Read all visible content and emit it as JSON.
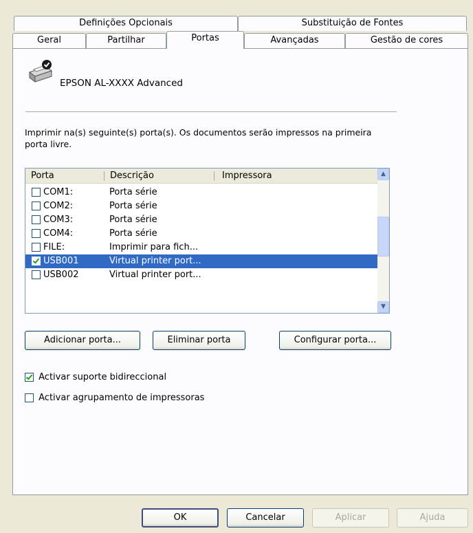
{
  "tabs": {
    "row1": [
      "Definições Opcionais",
      "Substituição de Fontes"
    ],
    "row2": [
      "Geral",
      "Partilhar",
      "Portas",
      "Avançadas",
      "Gestão de cores"
    ]
  },
  "printer": {
    "name": "EPSON AL-XXXX Advanced",
    "icon": "printer-icon"
  },
  "instruction": "Imprimir na(s) seguinte(s) porta(s). Os documentos serão impressos na primeira porta livre.",
  "ports_table": {
    "columns": [
      "Porta",
      "Descrição",
      "Impressora"
    ],
    "rows": [
      {
        "port": "COM1:",
        "description": "Porta série",
        "printer": "",
        "checked": false,
        "selected": false
      },
      {
        "port": "COM2:",
        "description": "Porta série",
        "printer": "",
        "checked": false,
        "selected": false
      },
      {
        "port": "COM3:",
        "description": "Porta série",
        "printer": "",
        "checked": false,
        "selected": false
      },
      {
        "port": "COM4:",
        "description": "Porta série",
        "printer": "",
        "checked": false,
        "selected": false
      },
      {
        "port": "FILE:",
        "description": "Imprimir para fich...",
        "printer": "",
        "checked": false,
        "selected": false
      },
      {
        "port": "USB001",
        "description": "Virtual printer port...",
        "printer": "",
        "checked": true,
        "selected": true
      },
      {
        "port": "USB002",
        "description": "Virtual printer port...",
        "printer": "",
        "checked": false,
        "selected": false
      }
    ]
  },
  "port_buttons": {
    "add": "Adicionar porta...",
    "delete": "Eliminar porta",
    "configure": "Configurar porta..."
  },
  "options": {
    "bidirectional": {
      "label": "Activar suporte bidireccional",
      "checked": true
    },
    "pooling": {
      "label": "Activar agrupamento de impressoras",
      "checked": false
    }
  },
  "dialog_buttons": {
    "ok": "OK",
    "cancel": "Cancelar",
    "apply": "Aplicar",
    "help": "Ajuda"
  },
  "colors": {
    "selection": "#316ac5",
    "dialog_bg": "#ece9d8",
    "panel_bg": "#fcfcfe"
  }
}
